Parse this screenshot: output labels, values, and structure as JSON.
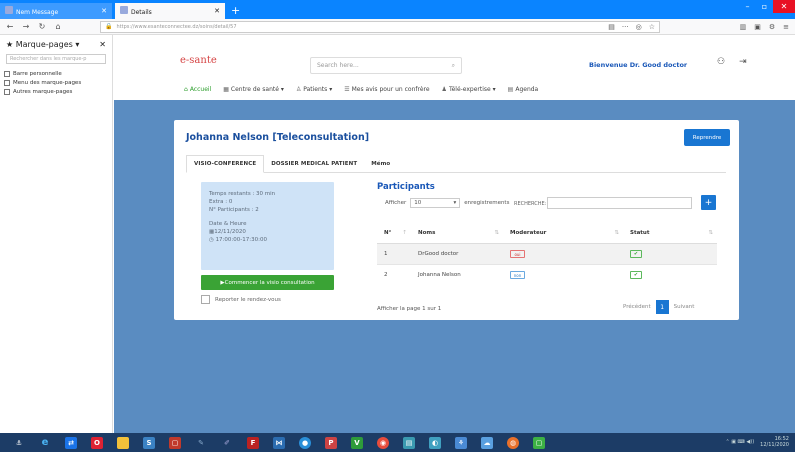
{
  "browser": {
    "tabs": [
      {
        "label": "Nem Message"
      },
      {
        "label": "Details"
      }
    ],
    "new_tab": "+",
    "url": "https://www.esanteconnectee.dz/soins/detail/57",
    "window_controls": {
      "min": "–",
      "max": "▫",
      "close": "✕"
    }
  },
  "bookmarks": {
    "title": "Marque-pages",
    "search_placeholder": "Rechercher dans les marque-p",
    "items": [
      {
        "label": "Barre personnelle"
      },
      {
        "label": "Menu des marque-pages"
      },
      {
        "label": "Autres marque-pages"
      }
    ]
  },
  "app": {
    "logo": "e-sante",
    "search_placeholder": "Search here...",
    "welcome": "Bienvenue Dr. Good doctor",
    "menu": [
      {
        "label": "Accueil",
        "icon": "home-icon"
      },
      {
        "label": "Centre de santé",
        "icon": "building-icon"
      },
      {
        "label": "Patients",
        "icon": "user-icon"
      },
      {
        "label": "Mes avis pour un confrère",
        "icon": "list-icon"
      },
      {
        "label": "Télé-expertise",
        "icon": "user-md-icon"
      },
      {
        "label": "Agenda",
        "icon": "calendar-icon"
      }
    ]
  },
  "consult": {
    "title": "Johanna Nelson [Teleconsultation]",
    "reprendre": "Reprendre",
    "tabs": [
      "VISIO-CONFERENCE",
      "DOSSIER MEDICAL PATIENT",
      "Mémo"
    ],
    "info": {
      "temps": "Temps restants : 30 min",
      "extra": "Extra : 0",
      "participants": "N° Participants : 2",
      "date_label": "Date & Heure",
      "date": "12/11/2020",
      "time": "17:00:00-17:30:00"
    },
    "start_button": "Commencer la visio consultation",
    "report_label": "Reporter le rendez-vous"
  },
  "participants": {
    "title": "Participants",
    "show_label": "Afficher",
    "show_value": "10",
    "records_label": "enregistrements",
    "search_label": "RECHERCHE:",
    "add": "+",
    "columns": [
      "N°",
      "Noms",
      "Moderateur",
      "Statut"
    ],
    "rows": [
      {
        "n": "1",
        "name": "DrGood doctor",
        "mod": "oui",
        "status": "✔"
      },
      {
        "n": "2",
        "name": "Johanna Nelson",
        "mod": "non",
        "status": "✔"
      }
    ],
    "page_info": "Afficher la page 1 sur 1",
    "prev": "Précédent",
    "page": "1",
    "next": "Suivant"
  },
  "taskbar": {
    "time": "16:52",
    "date": "12/11/2020"
  },
  "colors": {
    "page_bg": "#5a8cc1",
    "primary": "#1976d2",
    "success": "#3aa335"
  }
}
